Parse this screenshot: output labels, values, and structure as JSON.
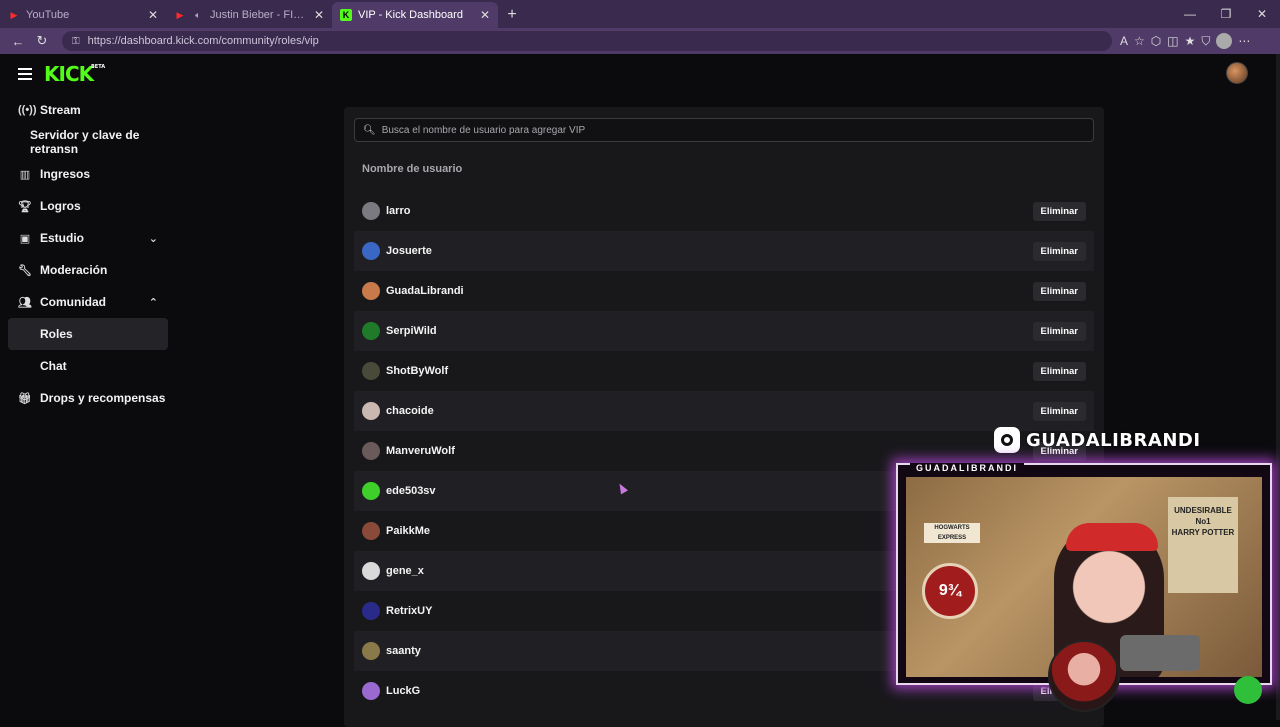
{
  "browser": {
    "tabs": [
      {
        "title": "YouTube",
        "favicon": "youtube-icon"
      },
      {
        "title": "Justin Bieber - FIRST PLACE (/",
        "favicon": "youtube-icon"
      },
      {
        "title": "VIP - Kick Dashboard",
        "favicon": "kick-icon"
      }
    ],
    "url": "https://dashboard.kick.com/community/roles/vip"
  },
  "app": {
    "logo": "KICK",
    "logo_badge": "BETA",
    "accent": "#53fc18"
  },
  "sidebar": {
    "items": [
      {
        "label": "Stream",
        "icon": "broadcast-icon"
      },
      {
        "label": "Servidor y clave de retransn",
        "icon": ""
      },
      {
        "label": "Ingresos",
        "icon": "chart-icon"
      },
      {
        "label": "Logros",
        "icon": "trophy-icon"
      },
      {
        "label": "Estudio",
        "icon": "studio-icon",
        "chevron": "down"
      },
      {
        "label": "Moderación",
        "icon": "wrench-icon"
      },
      {
        "label": "Comunidad",
        "icon": "community-icon",
        "chevron": "up"
      },
      {
        "label": "Roles",
        "icon": "",
        "active": true
      },
      {
        "label": "Chat",
        "icon": ""
      },
      {
        "label": "Drops y recompensas",
        "icon": "gift-icon"
      }
    ]
  },
  "vip": {
    "search_placeholder": "Busca el nombre de usuario para agregar VIP",
    "column_header": "Nombre de usuario",
    "remove_label": "Eliminar",
    "users": [
      {
        "name": "larro",
        "color": "#7a7a80"
      },
      {
        "name": "Josuerte",
        "color": "#3a66c4"
      },
      {
        "name": "GuadaLibrandi",
        "color": "#c97a4a"
      },
      {
        "name": "SerpiWild",
        "color": "#1f7a2a"
      },
      {
        "name": "ShotByWolf",
        "color": "#4a4a3a"
      },
      {
        "name": "chacoide",
        "color": "#c9b8b0"
      },
      {
        "name": "ManveruWolf",
        "color": "#6a5a5a"
      },
      {
        "name": "ede503sv",
        "color": "#3ecf2a"
      },
      {
        "name": "PaikkMe",
        "color": "#8a4a3a"
      },
      {
        "name": "gene_x",
        "color": "#d9d9d9"
      },
      {
        "name": "RetrixUY",
        "color": "#2a2a8a"
      },
      {
        "name": "saanty",
        "color": "#8a7a4a"
      },
      {
        "name": "LuckG",
        "color": "#9a6ad0"
      }
    ]
  },
  "overlay": {
    "handle": "GUADALIBRANDI",
    "cam_label": "GUADALIBRANDI",
    "poster_text": "UNDESIRABLE\nNo1\nHARRY POTTER",
    "platform_text": "9¾",
    "hogwarts_text": "HOGWARTS EXPRESS"
  }
}
